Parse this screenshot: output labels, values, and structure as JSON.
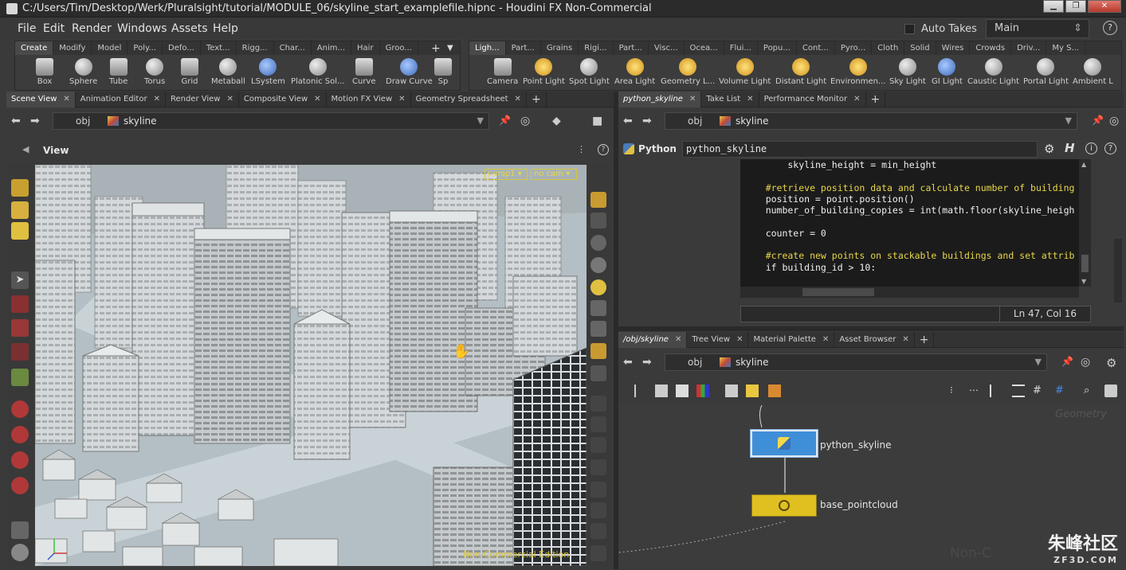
{
  "window": {
    "title": "C:/Users/Tim/Desktop/Werk/Pluralsight/tutorial/MODULE_06/skyline_start_examplefile.hipnc - Houdini FX Non-Commercial"
  },
  "menu": [
    "File",
    "Edit",
    "Render",
    "Windows",
    "Assets",
    "Help"
  ],
  "takes": {
    "auto_takes_label": "Auto Takes",
    "current_take": "Main"
  },
  "shelf_left": {
    "tabs": [
      "Create",
      "Modify",
      "Model",
      "Poly...",
      "Defo...",
      "Text...",
      "Rigg...",
      "Char...",
      "Anim...",
      "Hair",
      "Groo..."
    ],
    "tools": [
      "Box",
      "Sphere",
      "Tube",
      "Torus",
      "Grid",
      "Metaball",
      "LSystem",
      "Platonic Sol...",
      "Curve",
      "Draw Curve",
      "Sp"
    ]
  },
  "shelf_right": {
    "tabs": [
      "Ligh...",
      "Part...",
      "Grains",
      "Rigi...",
      "Part...",
      "Visc...",
      "Ocea...",
      "Flui...",
      "Popu...",
      "Cont...",
      "Pyro...",
      "Cloth",
      "Solid",
      "Wires",
      "Crowds",
      "Driv...",
      "My S..."
    ],
    "tools": [
      "Camera",
      "Point Light",
      "Spot Light",
      "Area Light",
      "Geometry L...",
      "Volume Light",
      "Distant Light",
      "Environmen...",
      "Sky Light",
      "GI Light",
      "Caustic Light",
      "Portal Light",
      "Ambient L"
    ]
  },
  "left_pane_tabs": [
    "Scene View",
    "Animation Editor",
    "Render View",
    "Composite View",
    "Motion FX View",
    "Geometry Spreadsheet"
  ],
  "right_top_tabs": [
    "python_skyline",
    "Take List",
    "Performance Monitor"
  ],
  "right_bottom_tabs": [
    "/obj/skyline",
    "Tree View",
    "Material Palette",
    "Asset Browser"
  ],
  "path": {
    "context": "obj",
    "node": "skyline"
  },
  "scene_view": {
    "title": "View",
    "camera_persp": "persp1",
    "camera_nocam": "no cam",
    "watermark": "Non-Commercial Edition"
  },
  "python_pane": {
    "label": "Python",
    "node_name": "python_skyline",
    "code": [
      {
        "t": "        skyline_height = min_height",
        "c": false
      },
      {
        "t": "",
        "c": false
      },
      {
        "t": "    #retrieve position data and calculate number of building",
        "c": true
      },
      {
        "t": "    position = point.position()",
        "c": false
      },
      {
        "t": "    number_of_building_copies = int(math.floor(skyline_heigh",
        "c": false
      },
      {
        "t": "",
        "c": false
      },
      {
        "t": "    counter = 0",
        "c": false
      },
      {
        "t": "",
        "c": false
      },
      {
        "t": "    #create new points on stackable buildings and set attrib",
        "c": true
      },
      {
        "t": "    if building_id > 10:",
        "c": false
      }
    ],
    "cursor": "Ln 47, Col 16"
  },
  "network": {
    "nodes": [
      {
        "name": "python_skyline",
        "color": "#3f8fd8"
      },
      {
        "name": "base_pointcloud",
        "color": "#e0c020"
      }
    ],
    "bg_label": "Geometry",
    "corner_watermark": "Non-C"
  },
  "site_watermark": {
    "brand": "朱峰社区",
    "url": "ZF3D.COM"
  }
}
